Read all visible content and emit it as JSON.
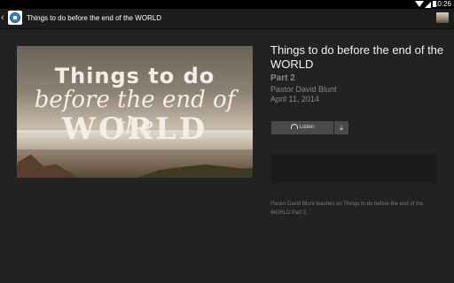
{
  "status_bar": {
    "time": "10:26"
  },
  "action_bar": {
    "back_glyph": "‹",
    "title": "Things to do before the end of the WORLD"
  },
  "hero": {
    "line1": "Things to do",
    "line2": "before the end of the",
    "line3": "WORLD"
  },
  "episode": {
    "title": "Things to do before the end of the WORLD",
    "part": "Part 2",
    "speaker": "Pastor David Blunt",
    "date": "April 11, 2014"
  },
  "actions": {
    "listen_label": "Listen",
    "download_glyph": "⤓"
  },
  "description": "Pastor David Blunt teaches on Things to do before the end of the WORLD Part 2."
}
